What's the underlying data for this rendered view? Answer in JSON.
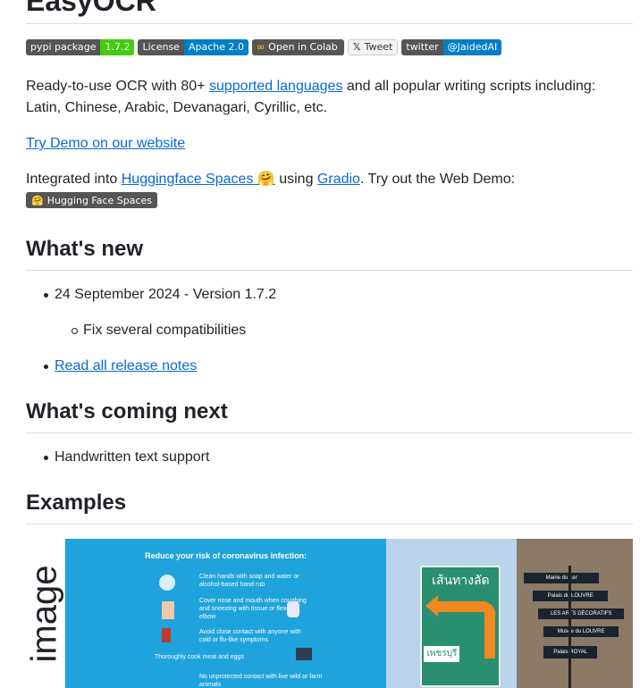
{
  "page": {
    "title": "EasyOCR",
    "badges": [
      {
        "left": "pypi package",
        "right": "1.7.2"
      },
      {
        "left": "License",
        "right": "Apache 2.0"
      },
      {
        "left": "Open in Colab"
      },
      {
        "left": "Tweet"
      },
      {
        "left": "twitter",
        "right": "@JaidedAI"
      }
    ],
    "intro": {
      "text_before": "Ready-to-use OCR with 80+ ",
      "link": "supported languages",
      "text_after": " and all popular writing scripts including: Latin, Chinese, Arabic, Devanagari, Cyrillic, etc."
    },
    "demo_link": "Try Demo on our website",
    "integrated": {
      "text_before": "Integrated into ",
      "link1": "Huggingface Spaces",
      "emoji": "🤗",
      "text_mid": " using ",
      "link2": "Gradio",
      "text_after": ". Try out the Web Demo:"
    },
    "hf_badge": "Hugging Face Spaces",
    "whats_new": {
      "heading": "What's new",
      "item1": "24 September 2024 - Version 1.7.2",
      "subitem1": "Fix several compatibilities",
      "release_link": "Read all release notes"
    },
    "whats_next": {
      "heading": "What's coming next",
      "item1": "Handwritten text support"
    },
    "examples": {
      "heading": "Examples",
      "image_label": "image",
      "corona_title": "Reduce your risk of coronavirus infection:",
      "corona_lines": [
        "Clean hands with soap and water or alcohol-based hand rub",
        "Cover nose and mouth when coughing and sneezing with tissue or flexed elbow",
        "Avoid close contact with anyone with cold or flu-like symptoms",
        "Thoroughly cook meat and eggs",
        "No unprotected contact with live wild or farm animals"
      ],
      "thai_top": "เส้นทางลัด",
      "thai_bottom": "เพชรบุรี",
      "street_signs": [
        "Mairie du 1er",
        "Palais du LOUVRE",
        "LES ARTS DÉCORATIFS",
        "Musée du LOUVRE",
        "Palais ROYAL"
      ]
    }
  }
}
